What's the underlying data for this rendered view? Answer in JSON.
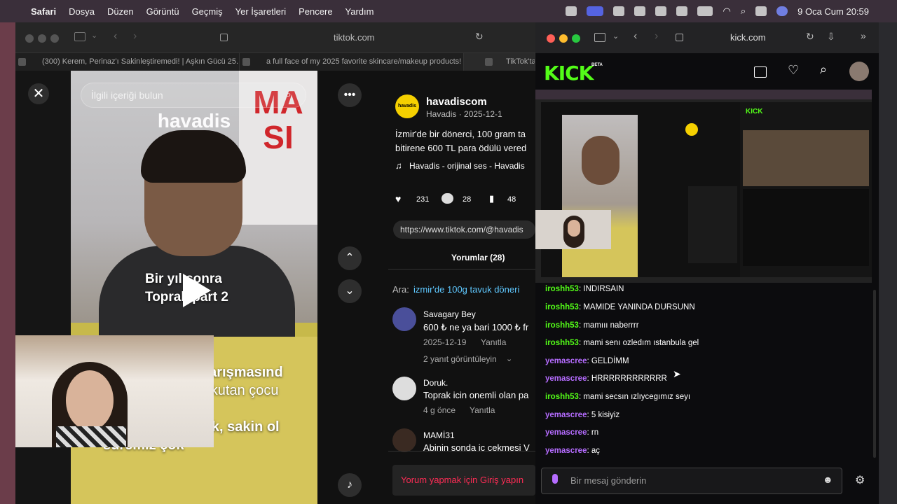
{
  "menubar": {
    "app": "Safari",
    "items": [
      "Dosya",
      "Düzen",
      "Görüntü",
      "Geçmiş",
      "Yer İşaretleri",
      "Pencere",
      "Yardım"
    ],
    "clock": "9 Oca Cum  20:59"
  },
  "left_window": {
    "url": "tiktok.com",
    "tabs": [
      {
        "title": "(300) Kerem, Perinaz'ı Sakinleştiremedi! | Aşkın Gücü 25. Bölü..."
      },
      {
        "title": "a full face of my 2025 favorite skincare/makeup products! #2..."
      },
      {
        "title": "TikTok'ta '..."
      }
    ],
    "video": {
      "search_placeholder": "İlgili içeriği bulun",
      "brand": "havadis",
      "banner_text": "MA SI",
      "overlay_line1": "Bir yıl sonra",
      "overlay_line2": "Toprak part 2",
      "caption_1": "yarışmasınd",
      "caption_2": "orkutan çocu",
      "caption_3": "d.",
      "caption_4": "rak, sakin ol",
      "caption_5": "süremiz çok\""
    },
    "post": {
      "account": "havadiscom",
      "avatar_text": "havadis",
      "meta": "Havadis · 2025-12-1",
      "desc_line1": "İzmir'de bir dönerci, 100 gram ta",
      "desc_line2": "bitirene 600 TL para ödülü vered",
      "sound": "Havadis - orijinal ses - Havadis",
      "likes": "231",
      "comments": "28",
      "saves": "48",
      "link": "https://www.tiktok.com/@havadis",
      "comments_tab": "Yorumlar (28)",
      "search_label": "Ara:",
      "search_term": "izmir'de 100g tavuk döneri"
    },
    "comment_list": [
      {
        "user": "Savagary Bey",
        "text": "600 ₺ ne ya bari 1000 ₺ fr",
        "date": "2025-12-19",
        "reply": "Yanıtla",
        "more": "2 yanıt görüntüleyin"
      },
      {
        "user": "Doruk.",
        "text": "Toprak icin onemli olan pa",
        "date": "4 g önce",
        "reply": "Yanıtla"
      },
      {
        "user": "MAMİ31",
        "text": "Abinin sonda ic cekmesi V"
      }
    ],
    "login_prompt": "Yorum yapmak için Giriş yapın"
  },
  "right_window": {
    "url": "kick.com",
    "logo": "KICK",
    "logo_beta": "BETA",
    "chat": [
      {
        "user": "iroshh53",
        "color": "green",
        "msg": "INDIRSAIN"
      },
      {
        "user": "iroshh53",
        "color": "green",
        "msg": "MAMIDE YANINDA DURSUNN"
      },
      {
        "user": "iroshh53",
        "color": "green",
        "msg": "mamııı naberrrr"
      },
      {
        "user": "iroshh53",
        "color": "green",
        "msg": "mami senı ozledım ıstanbula gel"
      },
      {
        "user": "yemascree",
        "color": "purple",
        "msg": "GELDİMM"
      },
      {
        "user": "yemascree",
        "color": "purple",
        "msg": "HRRRRRRRRRRRR"
      },
      {
        "user": "iroshh53",
        "color": "green",
        "msg": "mami secsın ızlıycegımız seyı"
      },
      {
        "user": "yemascree",
        "color": "purple",
        "msg": "5 kisiyiz"
      },
      {
        "user": "yemascree",
        "color": "purple",
        "msg": "rn"
      },
      {
        "user": "yemascree",
        "color": "purple",
        "msg": "aç"
      }
    ],
    "chat_placeholder": "Bir mesaj gönderin"
  },
  "colors": {
    "kick_green": "#53fc18",
    "chat_purple": "#b56cff",
    "login_red": "#fe2c55"
  }
}
